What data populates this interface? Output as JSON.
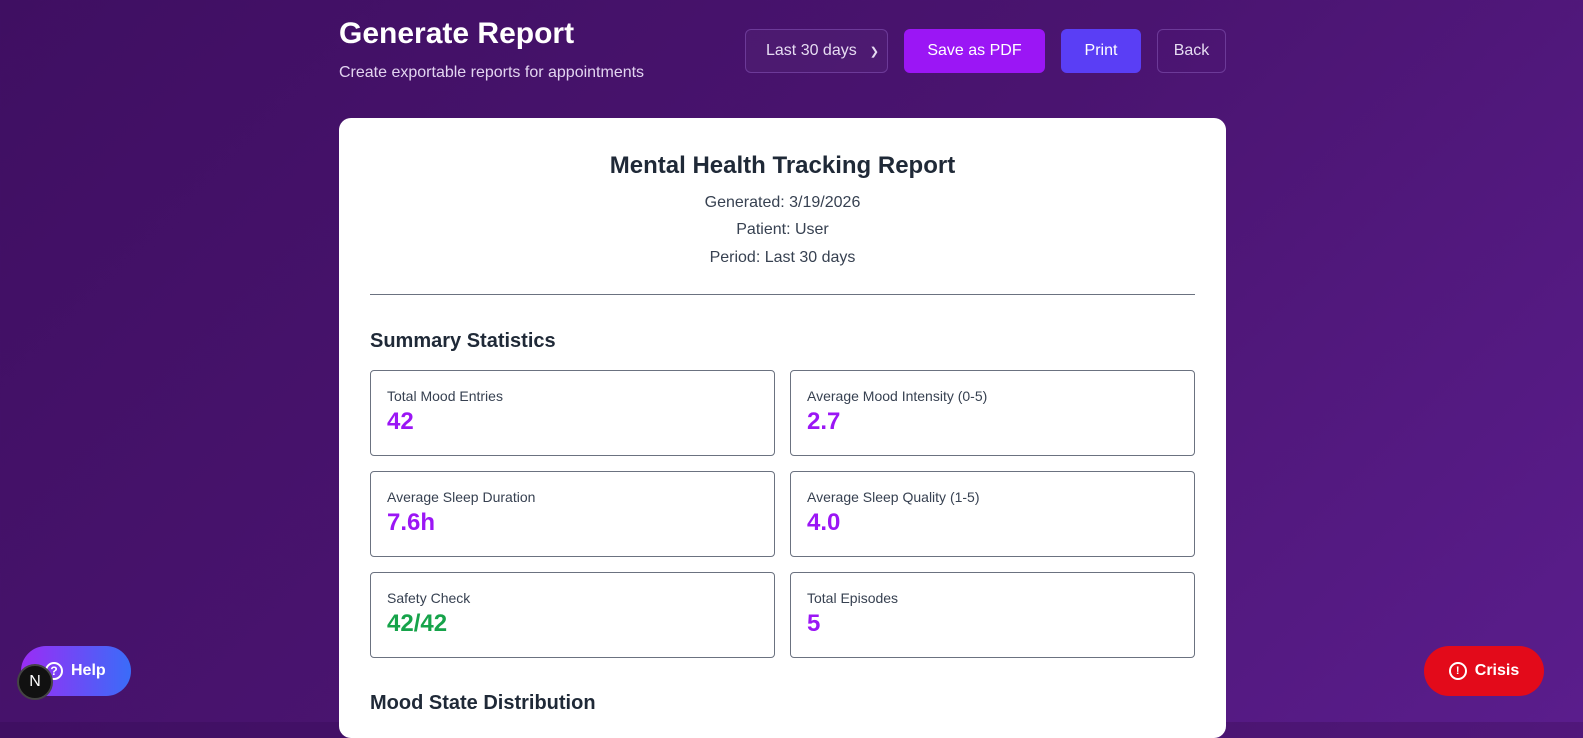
{
  "header": {
    "title": "Generate Report",
    "subtitle": "Create exportable reports for appointments",
    "period_select": "Last 30 days",
    "save_pdf": "Save as PDF",
    "print": "Print",
    "back": "Back"
  },
  "report": {
    "title": "Mental Health Tracking Report",
    "generated": "Generated: 3/19/2026",
    "patient": "Patient: User",
    "period": "Period: Last 30 days",
    "summary_heading": "Summary Statistics",
    "stats": [
      {
        "label": "Total Mood Entries",
        "value": "42",
        "color": "#9b16f5"
      },
      {
        "label": "Average Mood Intensity (0-5)",
        "value": "2.7",
        "color": "#9b16f5"
      },
      {
        "label": "Average Sleep Duration",
        "value": "7.6h",
        "color": "#9b16f5"
      },
      {
        "label": "Average Sleep Quality (1-5)",
        "value": "4.0",
        "color": "#9b16f5"
      },
      {
        "label": "Safety Check",
        "value": "42/42",
        "color": "#16a34a"
      },
      {
        "label": "Total Episodes",
        "value": "5",
        "color": "#9b16f5"
      }
    ],
    "mood_heading": "Mood State Distribution"
  },
  "floating": {
    "help": "Help",
    "crisis": "Crisis",
    "dev_badge": "N"
  }
}
